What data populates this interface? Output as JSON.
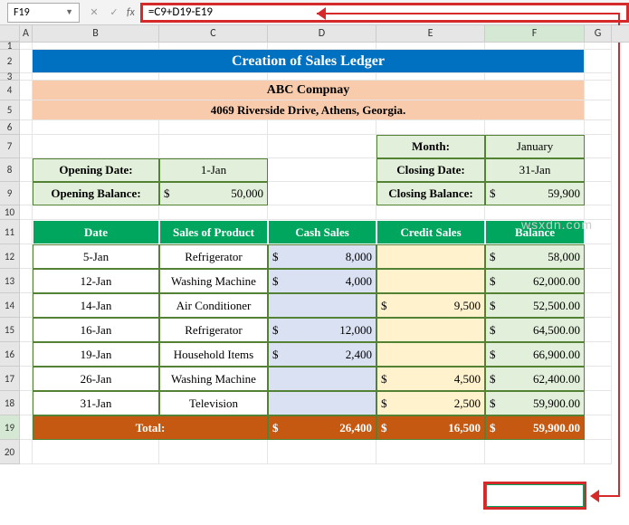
{
  "nameBox": "F19",
  "formula": "=C9+D19-E19",
  "watermark": "wsxdn.com",
  "cols": [
    "A",
    "B",
    "C",
    "D",
    "E",
    "F",
    "G"
  ],
  "title": "Creation of Sales Ledger",
  "company": {
    "name": "ABC Compnay",
    "addr": "4069 Riverside Drive, Athens, Georgia."
  },
  "labels": {
    "month": "Month:",
    "monthVal": "January",
    "openDate": "Opening Date:",
    "openDateVal": "1-Jan",
    "closeDate": "Closing Date:",
    "closeDateVal": "31-Jan",
    "openBal": "Opening Balance:",
    "openBalVal": "50,000",
    "closeBal": "Closing Balance:",
    "closeBalVal": "59,900"
  },
  "headers": {
    "date": "Date",
    "prod": "Sales of Product",
    "cash": "Cash Sales",
    "credit": "Credit Sales",
    "bal": "Balance"
  },
  "rows": [
    {
      "d": "5-Jan",
      "p": "Refrigerator",
      "cash": "8,000",
      "credit": "",
      "bal": "58,000"
    },
    {
      "d": "12-Jan",
      "p": "Washing Machine",
      "cash": "4,000",
      "credit": "",
      "bal": "62,000.00"
    },
    {
      "d": "14-Jan",
      "p": "Air Conditioner",
      "cash": "",
      "credit": "9,500",
      "bal": "52,500.00"
    },
    {
      "d": "16-Jan",
      "p": "Refrigerator",
      "cash": "12,000",
      "credit": "",
      "bal": "64,500.00"
    },
    {
      "d": "19-Jan",
      "p": "Household Items",
      "cash": "2,400",
      "credit": "",
      "bal": "66,900.00"
    },
    {
      "d": "26-Jan",
      "p": "Washing Machine",
      "cash": "",
      "credit": "4,500",
      "bal": "62,400.00"
    },
    {
      "d": "31-Jan",
      "p": "Television",
      "cash": "",
      "credit": "2,500",
      "bal": "59,900.00"
    }
  ],
  "total": {
    "lbl": "Total:",
    "cash": "26,400",
    "credit": "16,500",
    "bal": "59,900.00"
  }
}
